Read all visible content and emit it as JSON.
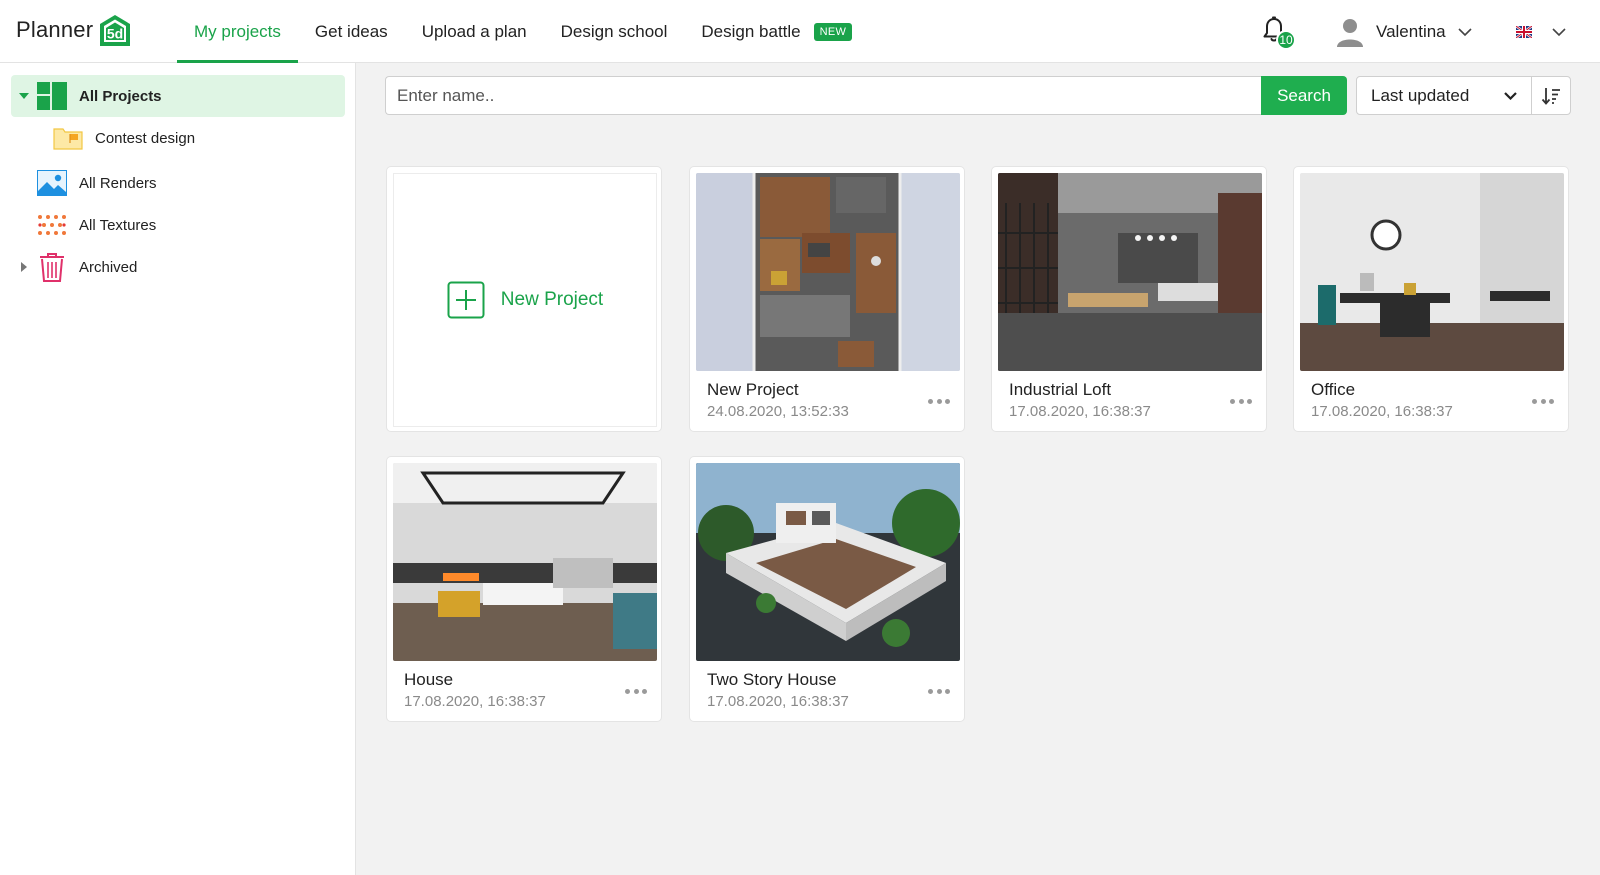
{
  "header": {
    "logo_text": "Planner",
    "logo_badge": "5d",
    "nav": [
      {
        "label": "My projects",
        "active": true
      },
      {
        "label": "Get ideas"
      },
      {
        "label": "Upload a plan"
      },
      {
        "label": "Design school"
      },
      {
        "label": "Design battle",
        "badge": "NEW"
      }
    ],
    "notifications_count": "10",
    "user_name": "Valentina",
    "language_icon": "uk-flag-icon"
  },
  "sidebar": {
    "items": [
      {
        "label": "All Projects",
        "icon": "projects-icon",
        "active": true,
        "expanded": true
      },
      {
        "label": "Contest design",
        "icon": "folder-flag-icon",
        "child": true
      },
      {
        "label": "All Renders",
        "icon": "image-icon"
      },
      {
        "label": "All Textures",
        "icon": "textures-icon"
      },
      {
        "label": "Archived",
        "icon": "trash-icon",
        "collapsed": true
      }
    ]
  },
  "toolbar": {
    "search_placeholder": "Enter name..",
    "search_value": "",
    "search_label": "Search",
    "sort_value": "Last updated",
    "sort_direction_icon": "sort-descending-icon"
  },
  "projects": {
    "new_project_label": "New Project",
    "cards": [
      {
        "name": "New Project",
        "date": "24.08.2020, 13:52:33"
      },
      {
        "name": "Industrial Loft",
        "date": "17.08.2020, 16:38:37"
      },
      {
        "name": "Office",
        "date": "17.08.2020, 16:38:37"
      },
      {
        "name": "House",
        "date": "17.08.2020, 16:38:37"
      },
      {
        "name": "Two Story House",
        "date": "17.08.2020, 16:38:37"
      }
    ]
  },
  "colors": {
    "accent": "#1aa34a",
    "active_bg": "#dff5e4",
    "date_text": "#8a8a8a"
  }
}
